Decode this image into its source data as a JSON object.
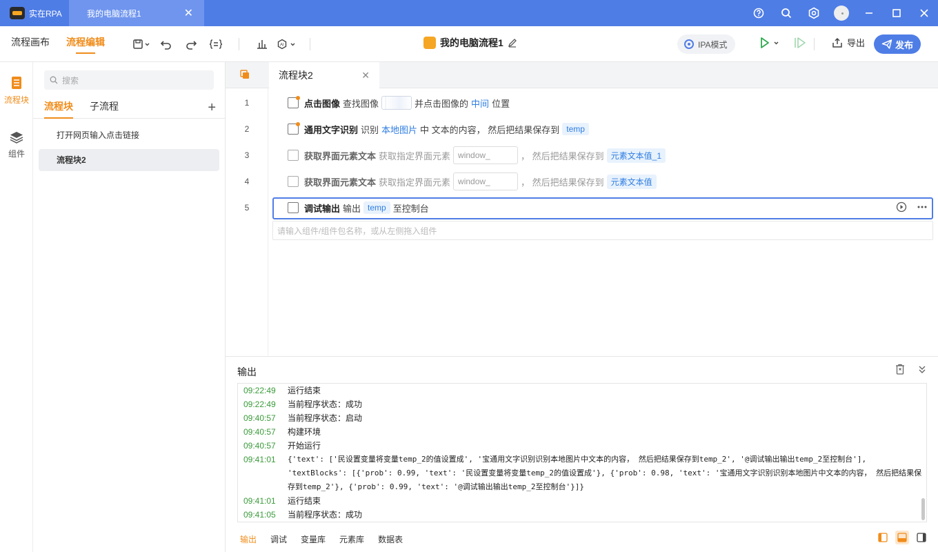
{
  "titlebar": {
    "app_name": "实在RPA",
    "file_tab": "我的电脑流程1",
    "close_glyph": "✕"
  },
  "toolbar": {
    "mode_canvas": "流程画布",
    "mode_edit": "流程编辑",
    "title": "我的电脑流程1",
    "ipa_mode": "IPA模式",
    "export": "导出",
    "publish": "发布"
  },
  "rail": {
    "blocks": "流程块",
    "components": "组件"
  },
  "side": {
    "search_placeholder": "搜索",
    "tab_blocks": "流程块",
    "tab_subflow": "子流程",
    "add": "+",
    "items": [
      {
        "label": "打开网页输入点击链接"
      },
      {
        "label": "流程块2"
      }
    ]
  },
  "editor": {
    "tab": "流程块2",
    "close": "✕",
    "lines": [
      "1",
      "2",
      "3",
      "4",
      "5"
    ],
    "steps": [
      {
        "name": "点击图像",
        "t1": "查找图像",
        "t2": "并点击图像的",
        "t3": "中间",
        "t4": "位置"
      },
      {
        "name": "通用文字识别",
        "t1": "识别",
        "t2": "本地图片",
        "t3": "中 文本的内容， 然后把结果保存到",
        "t4": "temp"
      },
      {
        "name": "获取界面元素文本",
        "t1": "获取指定界面元素",
        "t2": "window_",
        "t3": "， 然后把结果保存到",
        "t4": "元素文本值_1"
      },
      {
        "name": "获取界面元素文本",
        "t1": "获取指定界面元素",
        "t2": "window_",
        "t3": "， 然后把结果保存到",
        "t4": "元素文本值"
      },
      {
        "name": "调试输出",
        "t1": "输出",
        "t2": "temp",
        "t3": "至控制台"
      }
    ],
    "add_placeholder": "请输入组件/组件包名称，或从左侧拖入组件"
  },
  "output": {
    "title": "输出",
    "logs": [
      {
        "time": "09:22:49",
        "msg": "运行结束"
      },
      {
        "time": "09:22:49",
        "msg": "当前程序状态：成功"
      },
      {
        "time": "09:40:57",
        "msg": "当前程序状态：启动"
      },
      {
        "time": "09:40:57",
        "msg": "构建环境"
      },
      {
        "time": "09:40:57",
        "msg": "开始运行"
      },
      {
        "time": "09:41:01",
        "msg": "{'text': ['民设置变量将变量temp_2的值设置成', '宝通用文字识别识别本地图片中文本的内容， 然后把结果保存到temp_2', '@调试输出输出temp_2至控制台'],\n'textBlocks': [{'prob': 0.99, 'text': '民设置变量将变量temp_2的值设置成'}, {'prob': 0.98, 'text': '宝通用文字识别识别本地图片中文本的内容， 然后把结果保存到temp_2'}, {'prob': 0.99, 'text': '@调试输出输出temp_2至控制台'}]}"
      },
      {
        "time": "09:41:01",
        "msg": "运行结束"
      },
      {
        "time": "09:41:05",
        "msg": "当前程序状态：成功"
      }
    ],
    "tabs": [
      "输出",
      "调试",
      "变量库",
      "元素库",
      "数据表"
    ]
  },
  "colors": {
    "titlebar": "#4f7de6",
    "accent": "#f08c1a",
    "link": "#2f7de1",
    "time_green": "#3a9a3a"
  }
}
